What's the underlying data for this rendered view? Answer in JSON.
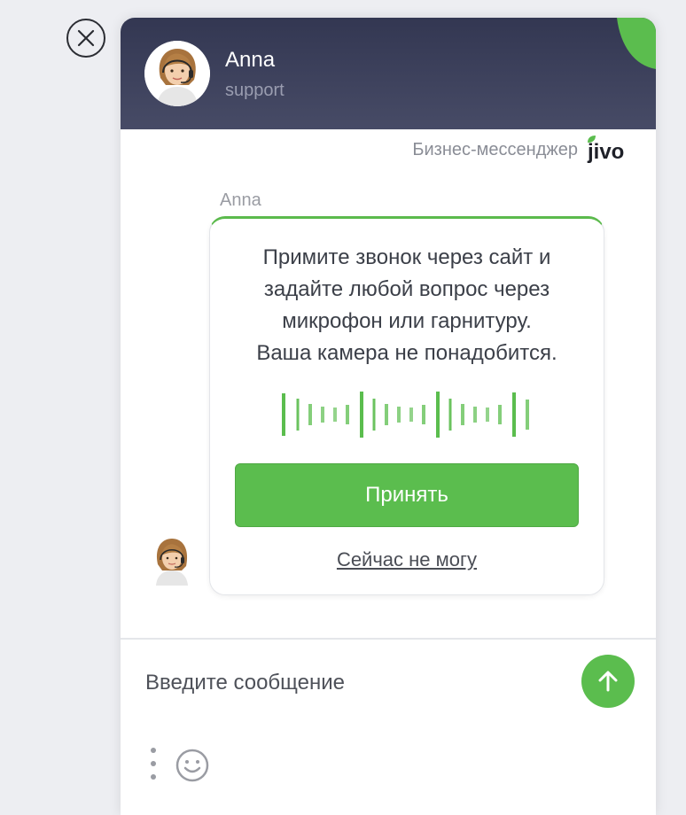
{
  "colors": {
    "accent": "#5bbd4e",
    "header": "#3a3e59",
    "text": "#3b3f48",
    "muted": "#8a8d96"
  },
  "header": {
    "agent_name": "Anna",
    "agent_role": "support"
  },
  "branding": {
    "text": "Бизнес-мессенджер",
    "logo": "jivo"
  },
  "chat": {
    "operator_label": "Anna",
    "call_card": {
      "lines": [
        "Примите звонок через сайт и",
        "задайте любой вопрос через",
        "микрофон или гарнитуру.",
        "Ваша камера не понадобится."
      ],
      "accept_label": "Принять",
      "decline_label": "Сейчас не могу"
    }
  },
  "composer": {
    "placeholder": "Введите сообщение"
  },
  "icons": {
    "close": "close-icon",
    "send": "arrow-up-icon",
    "more": "vertical-dots-icon",
    "emoji": "smile-icon",
    "wave": "sound-wave-icon"
  }
}
